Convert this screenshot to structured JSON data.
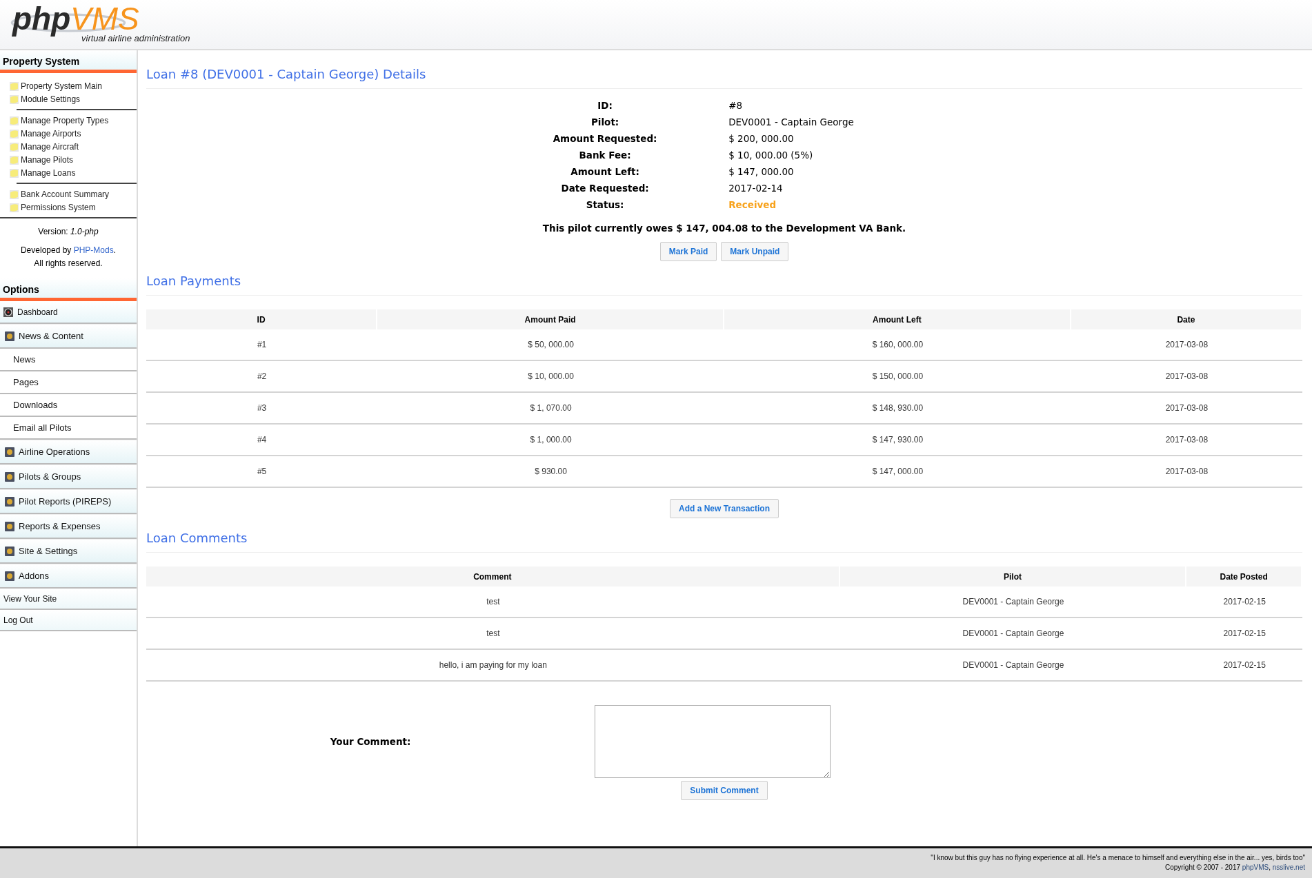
{
  "header": {
    "logo_dark": "php",
    "logo_accent": "VMS",
    "tagline": "virtual airline administration"
  },
  "sidebar": {
    "property_title": "Property System",
    "property_groups": [
      [
        "Property System Main",
        "Module Settings"
      ],
      [
        "Manage Property Types",
        "Manage Airports",
        "Manage Aircraft",
        "Manage Pilots",
        "Manage Loans"
      ],
      [
        "Bank Account Summary",
        "Permissions System"
      ]
    ],
    "version": "Version: *1.0-php*",
    "developed_prefix": "Developed by ",
    "developed_link": "PHP-Mods",
    "developed_suffix": ".",
    "rights": "All rights reserved.",
    "options_title": "Options",
    "options": [
      {
        "label": "Dashboard",
        "kind": "top"
      },
      {
        "label": "News & Content",
        "kind": "section"
      },
      {
        "label": "News",
        "kind": "sub"
      },
      {
        "label": "Pages",
        "kind": "sub"
      },
      {
        "label": "Downloads",
        "kind": "sub"
      },
      {
        "label": "Email all Pilots",
        "kind": "sub"
      },
      {
        "label": "Airline Operations",
        "kind": "section"
      },
      {
        "label": "Pilots & Groups",
        "kind": "section"
      },
      {
        "label": "Pilot Reports (PIREPS)",
        "kind": "section"
      },
      {
        "label": "Reports & Expenses",
        "kind": "section"
      },
      {
        "label": "Site & Settings",
        "kind": "section"
      },
      {
        "label": "Addons",
        "kind": "section"
      },
      {
        "label": "View Your Site",
        "kind": "link"
      },
      {
        "label": "Log Out",
        "kind": "link"
      }
    ]
  },
  "details": {
    "title": "Loan #8 (DEV0001 - Captain George) Details",
    "fields": [
      {
        "label": "ID:",
        "value": "#8",
        "kind": "text"
      },
      {
        "label": "Pilot:",
        "value": "DEV0001 - Captain George",
        "kind": "text"
      },
      {
        "label": "Amount Requested:",
        "value": "$ 200, 000.00",
        "kind": "text"
      },
      {
        "label": "Bank Fee:",
        "value": "$ 10, 000.00 (5%)",
        "kind": "text"
      },
      {
        "label": "Amount Left:",
        "value": "$ 147, 000.00",
        "kind": "text"
      },
      {
        "label": "Date Requested:",
        "value": "2017-02-14",
        "kind": "text"
      },
      {
        "label": "Status:",
        "value": "Received",
        "kind": "status"
      }
    ],
    "notice": "This pilot currently owes $ 147, 004.08 to the Development VA Bank.",
    "buttons": [
      "Mark Paid",
      "Mark Unpaid"
    ]
  },
  "payments": {
    "title": "Loan Payments",
    "columns": [
      "ID",
      "Amount Paid",
      "Amount Left",
      "Date"
    ],
    "rows": [
      [
        "#1",
        "$ 50, 000.00",
        "$ 160, 000.00",
        "2017-03-08"
      ],
      [
        "#2",
        "$ 10, 000.00",
        "$ 150, 000.00",
        "2017-03-08"
      ],
      [
        "#3",
        "$ 1, 070.00",
        "$ 148, 930.00",
        "2017-03-08"
      ],
      [
        "#4",
        "$ 1, 000.00",
        "$ 147, 930.00",
        "2017-03-08"
      ],
      [
        "#5",
        "$ 930.00",
        "$ 147, 000.00",
        "2017-03-08"
      ]
    ],
    "add_button": "Add a New Transaction"
  },
  "comments": {
    "title": "Loan Comments",
    "columns": [
      "Comment",
      "Pilot",
      "Date Posted"
    ],
    "rows": [
      [
        "test",
        "DEV0001 - Captain George",
        "2017-02-15"
      ],
      [
        "test",
        "DEV0001 - Captain George",
        "2017-02-15"
      ],
      [
        "hello, i am paying for my loan",
        "DEV0001 - Captain George",
        "2017-02-15"
      ]
    ],
    "form_label": "Your Comment:",
    "submit": "Submit Comment"
  },
  "footer": {
    "quote": "\"I know but this guy has no flying experience at all. He's a menace to himself and everything else in the air... yes, birds too\"",
    "copyright": "Copyright © 2007 - 2017 ",
    "links": [
      "phpVMS",
      ", ",
      "nsslive.net"
    ]
  }
}
